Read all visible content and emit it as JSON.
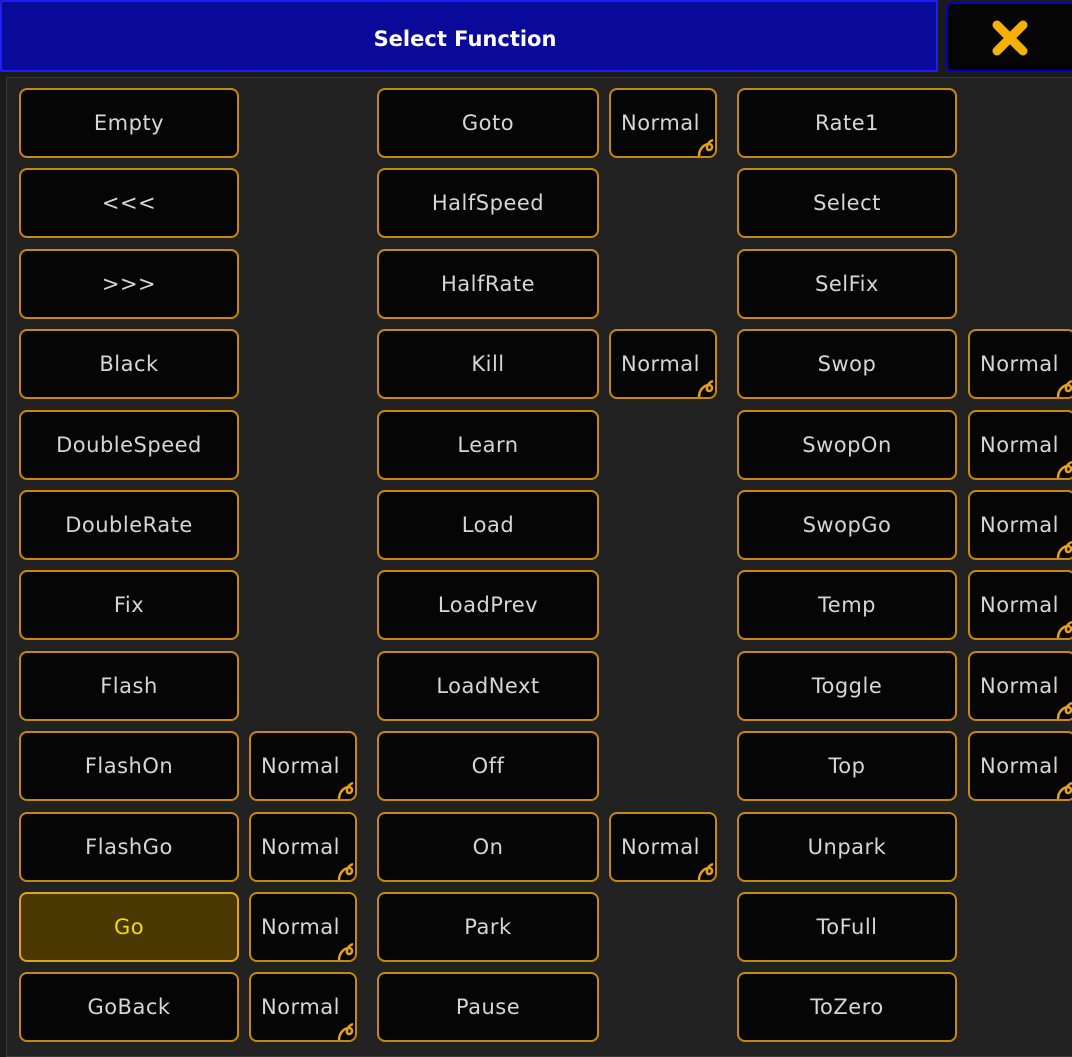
{
  "dialog": {
    "title": "Select Function",
    "close_icon": "close-x-icon"
  },
  "colors": {
    "title_bg": "#0a0a9a",
    "button_border": "#c8870e",
    "button_bg": "#050505",
    "selected_bg": "#4a3800",
    "selected_text": "#f0dc00",
    "close_icon": "#f5b000"
  },
  "selected_function": "Go",
  "columns": [
    {
      "items": [
        {
          "label": "Empty"
        },
        {
          "label": "<<<"
        },
        {
          "label": ">>>"
        },
        {
          "label": "Black"
        },
        {
          "label": "DoubleSpeed"
        },
        {
          "label": "DoubleRate"
        },
        {
          "label": "Fix"
        },
        {
          "label": "Flash"
        },
        {
          "label": "FlashOn",
          "mode": "Normal"
        },
        {
          "label": "FlashGo",
          "mode": "Normal"
        },
        {
          "label": "Go",
          "mode": "Normal"
        },
        {
          "label": "GoBack",
          "mode": "Normal"
        }
      ]
    },
    {
      "items": [
        {
          "label": "Goto",
          "mode": "Normal"
        },
        {
          "label": "HalfSpeed"
        },
        {
          "label": "HalfRate"
        },
        {
          "label": "Kill",
          "mode": "Normal"
        },
        {
          "label": "Learn"
        },
        {
          "label": "Load"
        },
        {
          "label": "LoadPrev"
        },
        {
          "label": "LoadNext"
        },
        {
          "label": "Off"
        },
        {
          "label": "On",
          "mode": "Normal"
        },
        {
          "label": "Park"
        },
        {
          "label": "Pause"
        }
      ]
    },
    {
      "items": [
        {
          "label": "Rate1"
        },
        {
          "label": "Select"
        },
        {
          "label": "SelFix"
        },
        {
          "label": "Swop",
          "mode": "Normal"
        },
        {
          "label": "SwopOn",
          "mode": "Normal"
        },
        {
          "label": "SwopGo",
          "mode": "Normal"
        },
        {
          "label": "Temp",
          "mode": "Normal"
        },
        {
          "label": "Toggle",
          "mode": "Normal"
        },
        {
          "label": "Top",
          "mode": "Normal"
        },
        {
          "label": "Unpark"
        },
        {
          "label": "ToFull"
        },
        {
          "label": "ToZero"
        }
      ]
    }
  ]
}
